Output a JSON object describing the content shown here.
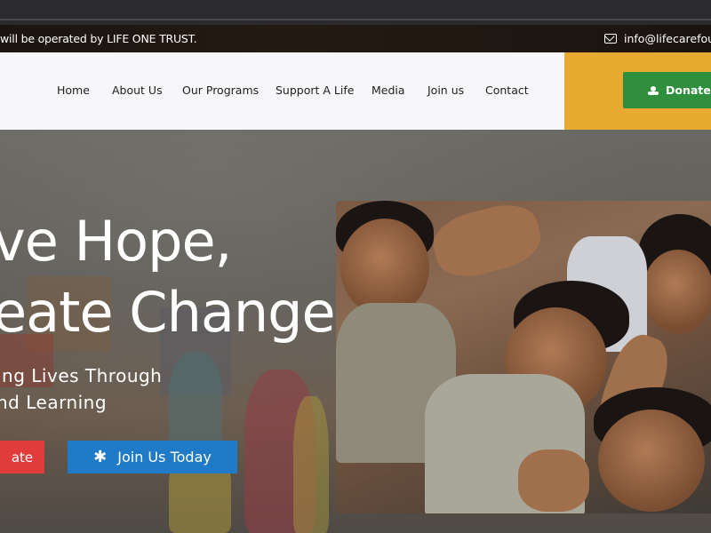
{
  "topbar": {
    "announcement": " will be operated by LIFE ONE TRUST.",
    "email": "info@lifecarefound",
    "mail_icon": "mail-icon"
  },
  "nav": {
    "items": [
      "Home",
      "About Us",
      "Our Programs",
      "Support A Life",
      "Media",
      "Join us",
      "Contact"
    ],
    "donate_label": "Donate",
    "donate_icon": "hand-heart-icon"
  },
  "hero": {
    "title_line1": "ve Hope,",
    "title_line2": "eate Change",
    "subtitle_line1": "ing Lives Through",
    "subtitle_line2": "nd Learning",
    "donate_button": "ate",
    "join_button": "Join Us Today",
    "join_icon": "asterisk-icon"
  },
  "colors": {
    "donate_panel": "#e8a930",
    "donate_button": "#2f8f3d",
    "red_button": "#e23b3b",
    "blue_button": "#1f7ac8"
  }
}
